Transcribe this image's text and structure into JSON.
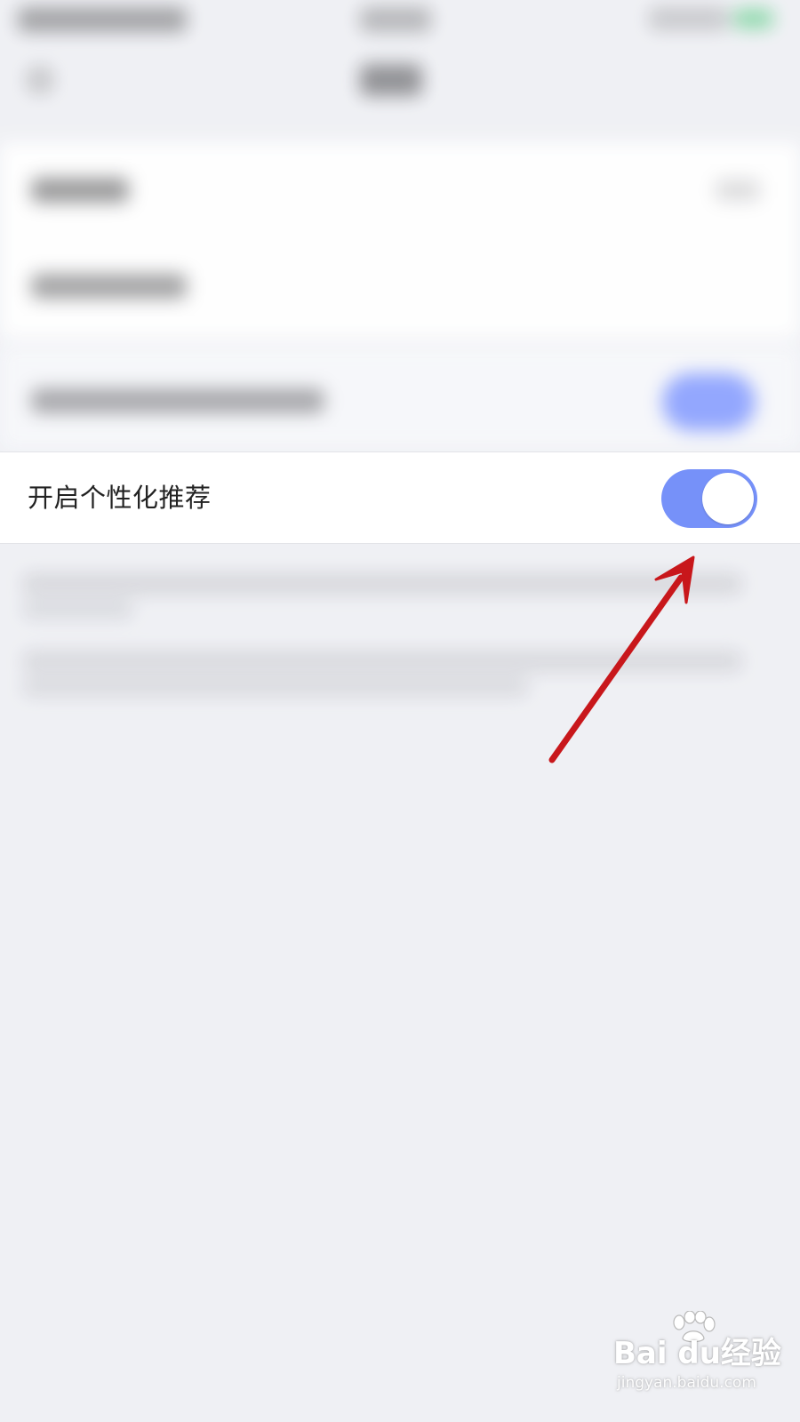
{
  "setting": {
    "label": "开启个性化推荐",
    "toggle_state": "on",
    "toggle_color": "#7691f9"
  },
  "annotation": {
    "arrow_color": "#c8171b"
  },
  "watermark": {
    "main": "Bai du经验",
    "sub": "jingyan.baidu.com"
  }
}
